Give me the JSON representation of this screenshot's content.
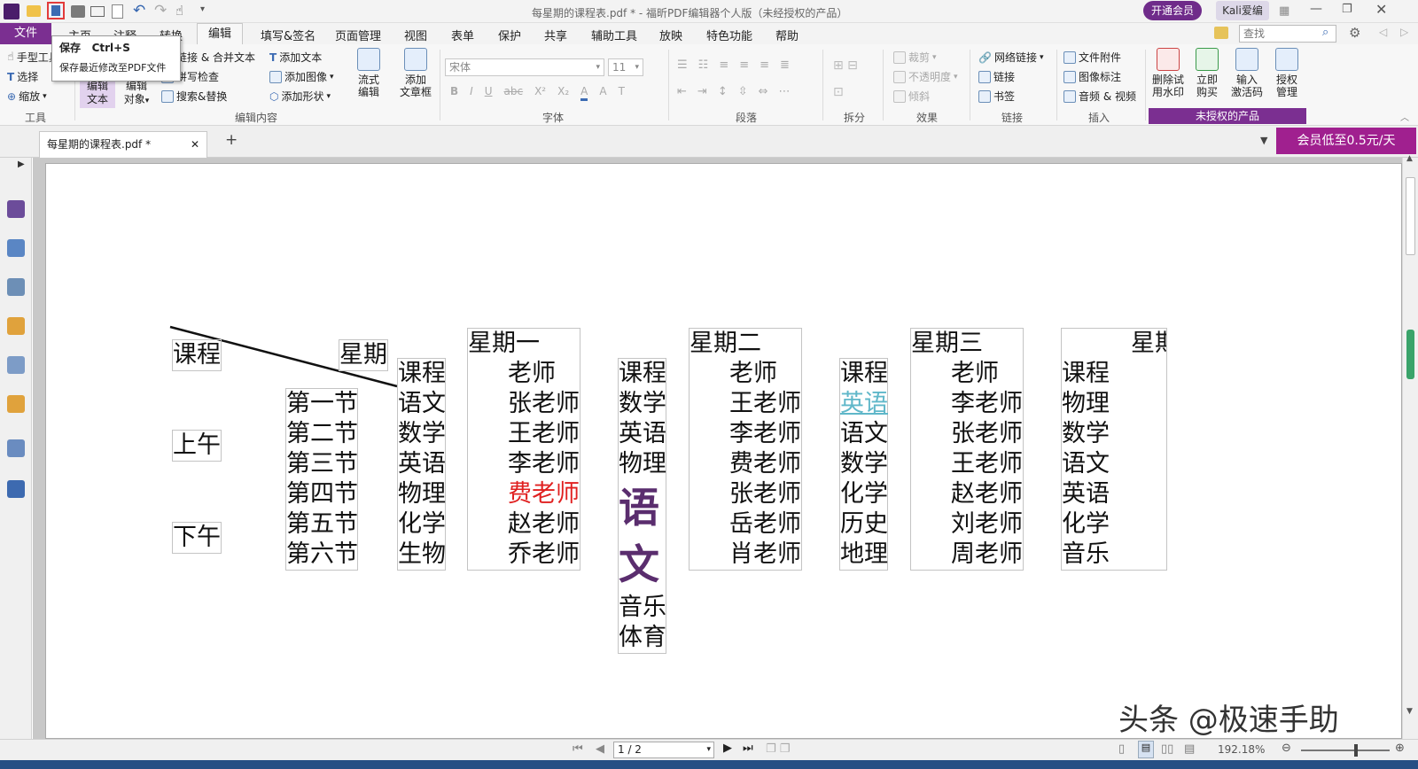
{
  "window": {
    "title": "每星期的课程表.pdf * - 福昕PDF编辑器个人版（未经授权的产品）",
    "vip_button": "开通会员",
    "user_name": "Kali爱编"
  },
  "tooltip": {
    "title": "保存",
    "shortcut": "Ctrl+S",
    "description": "保存最近修改至PDF文件"
  },
  "menu": {
    "file": "文件",
    "items": [
      "主页",
      "注释",
      "转换",
      "编辑",
      "填写&签名",
      "页面管理",
      "视图",
      "表单",
      "保护",
      "共享",
      "辅助工具",
      "放映",
      "特色功能",
      "帮助"
    ],
    "active": "编辑",
    "search_placeholder": "查找"
  },
  "ribbon": {
    "tools": {
      "hand": "手型工具",
      "select": "选择",
      "zoom": "缩放",
      "label": "工具"
    },
    "edit_content": {
      "edit_text": [
        "编辑",
        "文本"
      ],
      "edit_object": [
        "编辑",
        "对象"
      ],
      "link_merge": "链接 & 合并文本",
      "spell_check": "拼写检查",
      "search_replace": "搜索&替换",
      "add_text": "添加文本",
      "add_image": "添加图像",
      "add_shape": "添加形状",
      "flow_edit": [
        "流式",
        "编辑"
      ],
      "add_article": [
        "添加",
        "文章框"
      ],
      "label": "编辑内容"
    },
    "font": {
      "family": "宋体",
      "size": "11",
      "label": "字体"
    },
    "paragraph": {
      "label": "段落"
    },
    "split": {
      "label": "拆分"
    },
    "effects": {
      "crop": "裁剪",
      "opacity": "不透明度",
      "skew": "倾斜",
      "label": "效果"
    },
    "links": {
      "web_link": "网络链接",
      "link": "链接",
      "bookmark": "书签",
      "label": "链接"
    },
    "insert": {
      "attachment": "文件附件",
      "image_annotation": "图像标注",
      "audio_video": "音频 & 视频",
      "label": "插入"
    },
    "license": {
      "remove_watermark": [
        "删除试",
        "用水印"
      ],
      "buy_now": [
        "立即",
        "购买"
      ],
      "activation": [
        "输入",
        "激活码"
      ],
      "license_manage": [
        "授权",
        "管理"
      ],
      "label": "未授权的产品"
    }
  },
  "tabs": {
    "document_tab": "每星期的课程表.pdf *",
    "promo": "会员低至0.5元/天"
  },
  "document": {
    "header_course": "课程",
    "header_weekday": "星期",
    "morning": "上午",
    "afternoon": "下午",
    "periods": [
      "第一节",
      "第二节",
      "第三节",
      "第四节",
      "第五节",
      "第六节"
    ],
    "days": [
      {
        "name": "星期一",
        "course_header": "课程",
        "courses": [
          "语文",
          "数学",
          "英语",
          "物理",
          "化学",
          "生物"
        ],
        "teacher_header": "老师",
        "teachers": [
          "张老师",
          "王老师",
          "李老师",
          "费老师",
          "赵老师",
          "乔老师"
        ]
      },
      {
        "name": "星期二",
        "course_header": "课程",
        "courses": [
          "数学",
          "英语",
          "物理",
          "语",
          "文",
          "音乐",
          "体育"
        ],
        "teacher_header": "老师",
        "teachers": [
          "王老师",
          "李老师",
          "费老师",
          "张老师",
          "岳老师",
          "肖老师"
        ]
      },
      {
        "name": "星期三",
        "course_header": "课程",
        "courses": [
          "英语",
          "语文",
          "数学",
          "化学",
          "历史",
          "地理"
        ],
        "teacher_header": "老师",
        "teachers": [
          "李老师",
          "张老师",
          "王老师",
          "赵老师",
          "刘老师",
          "周老师"
        ]
      },
      {
        "name": "星期",
        "course_header": "课程",
        "courses": [
          "物理",
          "数学",
          "语文",
          "英语",
          "化学",
          "音乐"
        ]
      }
    ],
    "highlight_red": "#e02020",
    "highlight_teal": "#5fb7c9",
    "bold_purple": "#5a2d6e"
  },
  "status": {
    "page": "1 / 2",
    "zoom": "192.18%"
  },
  "watermark": "头条 @极速手助"
}
